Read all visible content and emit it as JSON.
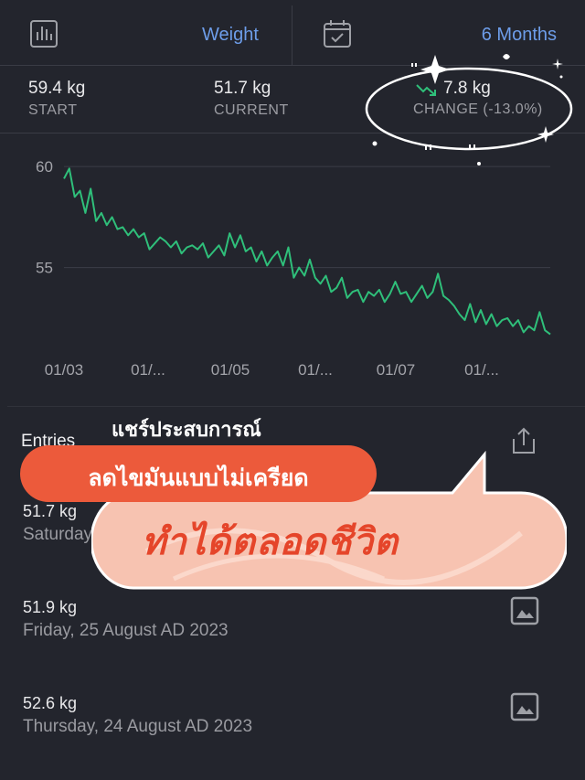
{
  "toolbar": {
    "chart_icon": "bar-chart-icon",
    "metric_label": "Weight",
    "calendar_icon": "calendar-check-icon",
    "range_label": "6 Months"
  },
  "stats": {
    "start_value": "59.4 kg",
    "start_label": "START",
    "current_value": "51.7 kg",
    "current_label": "CURRENT",
    "change_value": "7.8 kg",
    "change_label": "CHANGE (-13.0%)",
    "trend_icon": "trending-down-icon",
    "trend_color": "#2fbf7a"
  },
  "chart_data": {
    "type": "line",
    "y_ticks": [
      "60",
      "55"
    ],
    "x_ticks": [
      "01/03",
      "01/...",
      "01/05",
      "01/...",
      "01/07",
      "01/..."
    ],
    "ylim": [
      51.5,
      61
    ],
    "grid": true,
    "line_color": "#2fbf7a",
    "series": [
      {
        "values": [
          59.4,
          59.9,
          58.5,
          58.8,
          57.7,
          58.9,
          57.3,
          57.7,
          57.1,
          57.5,
          56.9,
          57.0,
          56.6,
          56.9,
          56.5,
          56.7,
          55.9,
          56.2,
          56.5,
          56.3,
          56.0,
          56.3,
          55.7,
          56.0,
          56.1,
          55.9,
          56.2,
          55.5,
          55.8,
          56.1,
          55.6,
          56.7,
          56.0,
          56.6,
          55.8,
          56.0,
          55.3,
          55.8,
          55.1,
          55.5,
          55.8,
          55.1,
          56.0,
          54.5,
          55.0,
          54.6,
          55.4,
          54.5,
          54.2,
          54.6,
          53.8,
          54.0,
          54.5,
          53.5,
          53.8,
          53.9,
          53.3,
          53.8,
          53.6,
          53.9,
          53.3,
          53.7,
          54.3,
          53.7,
          53.8,
          53.3,
          53.7,
          54.1,
          53.5,
          53.8,
          54.7,
          53.6,
          53.4,
          53.1,
          52.7,
          52.4,
          53.2,
          52.3,
          52.9,
          52.2,
          52.7,
          52.1,
          52.4,
          52.5,
          52.1,
          52.4,
          51.8,
          52.1,
          51.9,
          52.8,
          51.9,
          51.7
        ]
      }
    ]
  },
  "entries": {
    "title": "Entries",
    "share_icon": "share-icon",
    "items": [
      {
        "weight": "51.7 kg",
        "date": "Saturday"
      },
      {
        "weight": "51.9 kg",
        "date": "Friday, 25 August AD 2023",
        "icon": "image-icon"
      },
      {
        "weight": "52.6 kg",
        "date": "Thursday, 24 August AD 2023",
        "icon": "image-icon"
      }
    ]
  },
  "overlay": {
    "caption": "แชร์ประสบการณ์",
    "pill_text": "ลดไขมันแบบไม่เครียด",
    "bubble_text": "ทำได้ตลอดชีวิต",
    "pill_color": "#ec5a3b",
    "bubble_color": "#f7c3b1"
  }
}
